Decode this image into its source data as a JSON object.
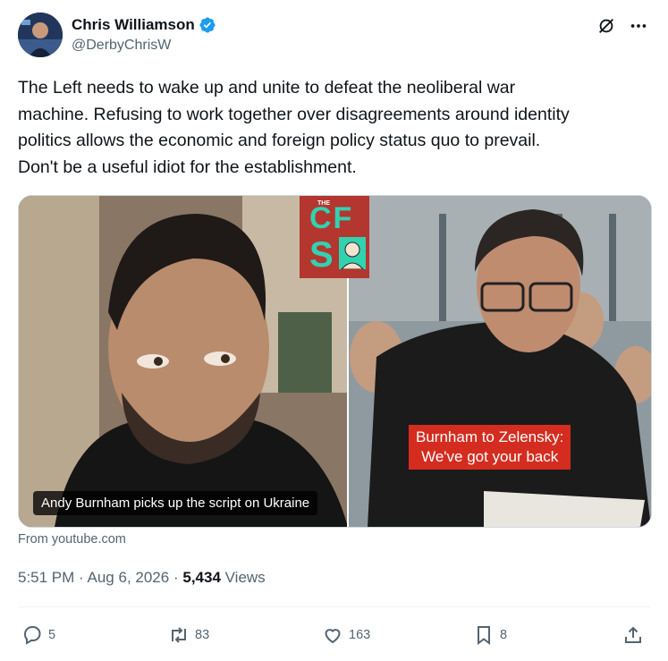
{
  "author": {
    "display_name": "Chris Williamson",
    "handle": "@DerbyChrisW",
    "verified": true
  },
  "tweet": {
    "text": "The Left needs to wake up and unite to defeat the neoliberal war\nmachine. Refusing to work together over disagreements around identity\npolitics allows the economic and foreign policy status quo to prevail.\nDon't be a useful idiot for the establishment."
  },
  "media": {
    "caption": "Andy Burnham picks up the script on Ukraine",
    "overlay_line1": "Burnham to Zelensky:",
    "overlay_line2": "We've got your back",
    "logo_small": "THE",
    "logo_line1": "CF",
    "logo_line2": "S",
    "source": "From youtube.com"
  },
  "meta": {
    "time": "5:51 PM",
    "date": "Aug 6, 2026",
    "views": "5,434",
    "views_label": "Views",
    "sep": "·"
  },
  "actions": {
    "replies": "5",
    "reposts": "83",
    "likes": "163",
    "bookmarks": "8"
  },
  "colors": {
    "accent": "#1d9bf0",
    "text": "#0f1419",
    "secondary": "#536471",
    "overlay_red": "#d42d20",
    "logo_teal": "#31d2b0"
  },
  "icons": [
    "verified-badge-icon",
    "grok-icon",
    "more-icon",
    "reply-icon",
    "repost-icon",
    "like-icon",
    "bookmark-icon",
    "share-icon"
  ]
}
